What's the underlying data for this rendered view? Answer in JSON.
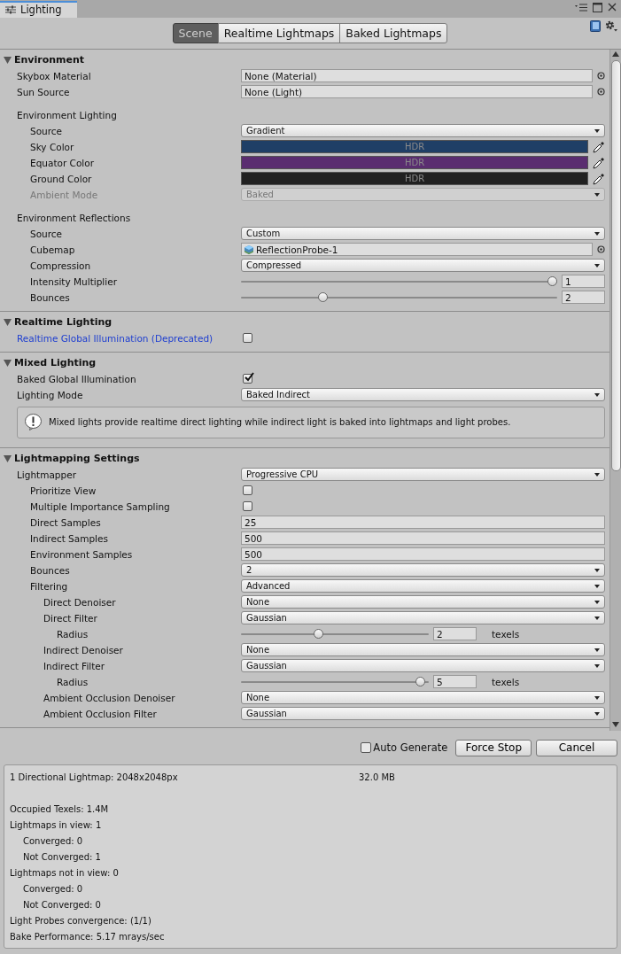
{
  "window": {
    "title": "Lighting"
  },
  "tabs": [
    {
      "label": "Scene",
      "selected": true
    },
    {
      "label": "Realtime Lightmaps",
      "selected": false
    },
    {
      "label": "Baked Lightmaps",
      "selected": false
    }
  ],
  "sections": [
    {
      "title": "Environment",
      "expanded": true,
      "rows": [
        {
          "kind": "object",
          "label": "Skybox Material",
          "value": "None (Material)"
        },
        {
          "kind": "object",
          "label": "Sun Source",
          "value": "None (Light)"
        },
        {
          "kind": "heading",
          "label": "Environment Lighting",
          "children": [
            {
              "kind": "dropdown",
              "label": "Source",
              "value": "Gradient"
            },
            {
              "kind": "color",
              "label": "Sky Color",
              "value": "HDR",
              "color": "#1f3f66"
            },
            {
              "kind": "color",
              "label": "Equator Color",
              "value": "HDR",
              "color": "#5a2d70"
            },
            {
              "kind": "color",
              "label": "Ground Color",
              "value": "HDR",
              "color": "#212121"
            },
            {
              "kind": "dropdown",
              "label": "Ambient Mode",
              "value": "Baked",
              "disabled": true
            }
          ]
        },
        {
          "kind": "heading",
          "label": "Environment Reflections",
          "children": [
            {
              "kind": "dropdown",
              "label": "Source",
              "value": "Custom"
            },
            {
              "kind": "object",
              "label": "Cubemap",
              "value": "ReflectionProbe-1",
              "icon": true
            },
            {
              "kind": "dropdown",
              "label": "Compression",
              "value": "Compressed"
            },
            {
              "kind": "slider",
              "label": "Intensity Multiplier",
              "value": "1",
              "level": 1
            },
            {
              "kind": "slider",
              "label": "Bounces",
              "value": "2",
              "level": 0.25
            }
          ]
        }
      ]
    },
    {
      "title": "Realtime Lighting",
      "expanded": true,
      "rows": [
        {
          "kind": "checkbox",
          "label": "Realtime Global Illumination (Deprecated)",
          "checked": false,
          "modified": true
        }
      ]
    },
    {
      "title": "Mixed Lighting",
      "expanded": true,
      "rows": [
        {
          "kind": "checkbox",
          "label": "Baked Global Illumination",
          "checked": true
        },
        {
          "kind": "dropdown",
          "label": "Lighting Mode",
          "value": "Baked Indirect"
        },
        {
          "kind": "help",
          "text": "Mixed lights provide realtime direct lighting while indirect light is baked into lightmaps and light probes."
        }
      ]
    },
    {
      "title": "Lightmapping Settings",
      "expanded": true,
      "rows": [
        {
          "kind": "dropdown",
          "label": "Lightmapper",
          "value": "Progressive CPU",
          "children": [
            {
              "kind": "checkbox",
              "label": "Prioritize View",
              "checked": false
            },
            {
              "kind": "checkbox",
              "label": "Multiple Importance Sampling",
              "checked": false
            },
            {
              "kind": "number",
              "label": "Direct Samples",
              "value": "25"
            },
            {
              "kind": "number",
              "label": "Indirect Samples",
              "value": "500"
            },
            {
              "kind": "number",
              "label": "Environment Samples",
              "value": "500"
            },
            {
              "kind": "dropdown",
              "label": "Bounces",
              "value": "2"
            },
            {
              "kind": "dropdown",
              "label": "Filtering",
              "value": "Advanced",
              "children": [
                {
                  "kind": "dropdown",
                  "label": "Direct Denoiser",
                  "value": "None"
                },
                {
                  "kind": "dropdown",
                  "label": "Direct Filter",
                  "value": "Gaussian",
                  "children": [
                    {
                      "kind": "slider",
                      "label": "Radius",
                      "value": "2",
                      "level": 0.41,
                      "unit": "texels"
                    }
                  ]
                },
                {
                  "kind": "dropdown",
                  "label": "Indirect Denoiser",
                  "value": "None"
                },
                {
                  "kind": "dropdown",
                  "label": "Indirect Filter",
                  "value": "Gaussian",
                  "children": [
                    {
                      "kind": "slider",
                      "label": "Radius",
                      "value": "5",
                      "level": 0.98,
                      "unit": "texels"
                    }
                  ]
                },
                {
                  "kind": "dropdown",
                  "label": "Ambient Occlusion Denoiser",
                  "value": "None"
                },
                {
                  "kind": "dropdown",
                  "label": "Ambient Occlusion Filter",
                  "value": "Gaussian"
                }
              ]
            }
          ]
        }
      ]
    }
  ],
  "footer": {
    "auto_generate": {
      "label": "Auto Generate",
      "checked": false
    },
    "buttons": [
      "Force Stop",
      "Cancel"
    ]
  },
  "stats": [
    {
      "label": "1 Directional Lightmap: 2048x2048px",
      "size": "32.0 MB"
    },
    {
      "label": "Occupied Texels: 1.4M"
    },
    {
      "label": "Lightmaps in view: 1",
      "children": [
        {
          "label": "Converged: 0"
        },
        {
          "label": "Not Converged: 1"
        }
      ]
    },
    {
      "label": "Lightmaps not in view: 0",
      "children": [
        {
          "label": "Converged: 0"
        },
        {
          "label": "Not Converged: 0"
        }
      ]
    },
    {
      "label": "Light Probes convergence: (1/1)"
    },
    {
      "label": "Bake Performance: 5.17 mrays/sec"
    }
  ]
}
